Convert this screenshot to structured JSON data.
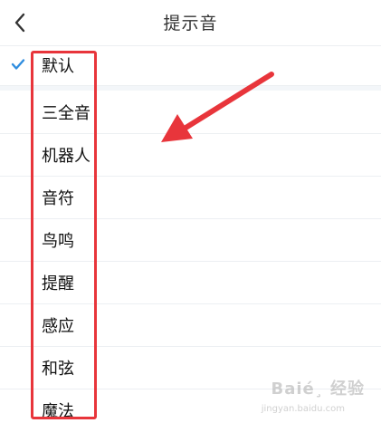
{
  "header": {
    "title": "提示音",
    "back_icon": "chevron-left-icon"
  },
  "tones": [
    {
      "label": "默认",
      "selected": true
    },
    {
      "label": "三全音",
      "selected": false
    },
    {
      "label": "机器人",
      "selected": false
    },
    {
      "label": "音符",
      "selected": false
    },
    {
      "label": "鸟鸣",
      "selected": false
    },
    {
      "label": "提醒",
      "selected": false
    },
    {
      "label": "感应",
      "selected": false
    },
    {
      "label": "和弦",
      "selected": false
    },
    {
      "label": "魔法",
      "selected": false
    }
  ],
  "colors": {
    "check": "#2f8ddf",
    "highlight": "#e8353b"
  },
  "watermark": {
    "text": "Baié¸ 经验",
    "sub": "jingyan.baidu.com"
  }
}
